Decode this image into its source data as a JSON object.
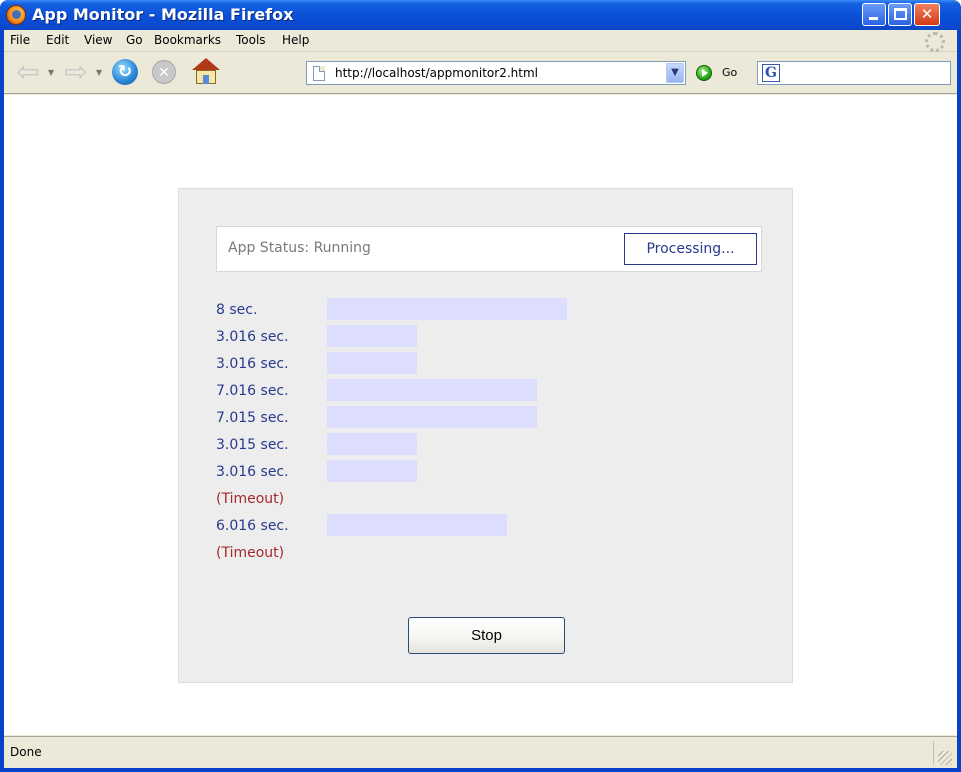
{
  "window": {
    "title": "App Monitor - Mozilla Firefox",
    "minimize": "",
    "maximize": "",
    "close": "✕"
  },
  "menubar": {
    "items": [
      "File",
      "Edit",
      "View",
      "Go",
      "Bookmarks",
      "Tools",
      "Help"
    ]
  },
  "navbar": {
    "back_icon": "back-arrow-icon",
    "forward_icon": "forward-arrow-icon",
    "url": "http://localhost/appmonitor2.html",
    "go_label": "Go",
    "search_engine_icon": "google-icon",
    "search_engine_glyph": "G",
    "search_value": ""
  },
  "app": {
    "status_text": "App Status: Running",
    "processing_label": "Processing...",
    "rows": [
      {
        "label": "8 sec.",
        "seconds": 8,
        "timeout": false
      },
      {
        "label": "3.016 sec.",
        "seconds": 3.016,
        "timeout": false
      },
      {
        "label": "3.016 sec.",
        "seconds": 3.016,
        "timeout": false
      },
      {
        "label": "7.016 sec.",
        "seconds": 7.016,
        "timeout": false
      },
      {
        "label": "7.015 sec.",
        "seconds": 7.015,
        "timeout": false
      },
      {
        "label": "3.015 sec.",
        "seconds": 3.015,
        "timeout": false
      },
      {
        "label": "3.016 sec.",
        "seconds": 3.016,
        "timeout": false
      },
      {
        "label": "(Timeout)",
        "seconds": null,
        "timeout": true
      },
      {
        "label": "6.016 sec.",
        "seconds": 6.016,
        "timeout": false
      },
      {
        "label": "(Timeout)",
        "seconds": null,
        "timeout": true
      }
    ],
    "stop_label": "Stop"
  },
  "statusbar": {
    "text": "Done"
  },
  "colors": {
    "titlebar": "#0a4fd8",
    "row_text": "#283a8c",
    "timeout_text": "#a52a2a",
    "bar_fill": "#ddddff",
    "panel_bg": "#ededed"
  }
}
